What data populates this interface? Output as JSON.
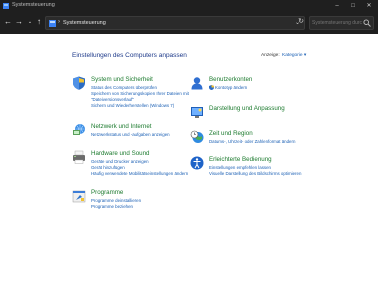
{
  "window": {
    "title": "Systemsteuerung",
    "minimize_glyph": "–",
    "maximize_glyph": "□",
    "close_glyph": "✕"
  },
  "toolbar": {
    "back_glyph": "←",
    "forward_glyph": "→",
    "history_glyph": "⌄",
    "up_glyph": "↑",
    "breadcrumb_sep": "›",
    "breadcrumb": "Systemsteuerung",
    "dropdown_glyph": "⌄",
    "refresh_glyph": "↻",
    "search_placeholder": "Systemsteuerung durchsu..."
  },
  "main": {
    "title": "Einstellungen des Computers anpassen",
    "view_label": "Anzeige:",
    "view_value": "Kategorie ▾"
  },
  "categories_left": [
    {
      "icon": "shield-icon",
      "heading": "System und Sicherheit",
      "links": [
        "Status des Computers überprüfen",
        "Speichern von Sicherungskopien Ihrer Dateien mit",
        "\"Dateiversionsverlauf\"",
        "Sichern und Wiederherstellen (Windows 7)"
      ]
    },
    {
      "icon": "network-icon",
      "heading": "Netzwerk und Internet",
      "links": [
        "Netzwerkstatus und -aufgaben anzeigen"
      ]
    },
    {
      "icon": "printer-icon",
      "heading": "Hardware und Sound",
      "links": [
        "Geräte und Drucker anzeigen",
        "Gerät hinzufügen",
        "Häufig verwendete Mobilitätseinstellungen ändern"
      ]
    },
    {
      "icon": "programs-icon",
      "heading": "Programme",
      "links": [
        "Programme deinstallieren",
        "Programme beziehen"
      ]
    }
  ],
  "categories_right": [
    {
      "icon": "user-accounts-icon",
      "heading": "Benutzerkonten",
      "links": [
        "Kontotyp ändern"
      ]
    },
    {
      "icon": "appearance-icon",
      "heading": "Darstellung und Anpassung",
      "links": []
    },
    {
      "icon": "clock-globe-icon",
      "heading": "Zeit und Region",
      "links": [
        "Datums-, Uhrzeit- oder Zahlenformat ändern"
      ]
    },
    {
      "icon": "accessibility-icon",
      "heading": "Erleichterte Bedienung",
      "links": [
        "Einstellungen empfehlen lassen",
        "Visuelle Darstellung des Bildschirms optimieren"
      ]
    }
  ],
  "colors": {
    "heading": "#1d7b2f",
    "link": "#1a5fb4",
    "title": "#1e3a8a",
    "chrome": "#1f1f1f"
  }
}
